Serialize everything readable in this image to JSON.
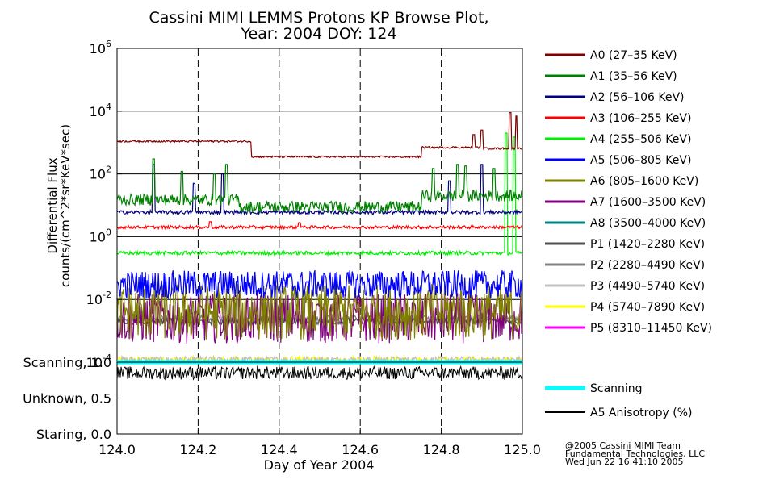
{
  "chart_data": {
    "type": "line",
    "title": "Cassini MIMI LEMMS Protons KP Browse Plot,",
    "subtitle": "Year: 2004 DOY: 124",
    "xlabel": "Day of Year 2004",
    "ylabel_line1": "Differential Flux",
    "ylabel_line2": "counts/(cm^2*sr*KeV*sec)",
    "x_ticks": [
      "124.0",
      "124.2",
      "124.4",
      "124.6",
      "124.8",
      "125.0"
    ],
    "xlim": [
      124.0,
      125.0
    ],
    "y_scale": "log",
    "ylim": [
      0.0001,
      1000000
    ],
    "y_ticks": [
      {
        "base": "10",
        "exp": "6",
        "value": 1000000
      },
      {
        "base": "10",
        "exp": "4",
        "value": 10000
      },
      {
        "base": "10",
        "exp": "2",
        "value": 100
      },
      {
        "base": "10",
        "exp": "0",
        "value": 1
      },
      {
        "base": "10",
        "exp": "-2",
        "value": 0.01
      },
      {
        "base": "10",
        "exp": "-4",
        "value": 0.0001
      }
    ],
    "grid": true,
    "legend_position": "right",
    "series": [
      {
        "name": "A0 (27–35 KeV)",
        "color": "#800000",
        "segments": [
          [
            124.0,
            124.33,
            1100
          ],
          [
            124.33,
            124.75,
            350
          ],
          [
            124.75,
            124.9,
            700
          ],
          [
            124.9,
            125.0,
            650
          ]
        ],
        "spikes": [
          [
            124.88,
            1800
          ],
          [
            124.9,
            2500
          ],
          [
            124.97,
            9000
          ],
          [
            124.985,
            7000
          ]
        ]
      },
      {
        "name": "A1 (35–56 KeV)",
        "color": "#008000",
        "segments": [
          [
            124.0,
            124.3,
            15
          ],
          [
            124.3,
            124.75,
            9
          ],
          [
            124.75,
            125.0,
            20
          ]
        ],
        "spikes": [
          [
            124.09,
            300
          ],
          [
            124.16,
            120
          ],
          [
            124.24,
            100
          ],
          [
            124.27,
            200
          ],
          [
            124.78,
            150
          ],
          [
            124.84,
            200
          ],
          [
            124.86,
            180
          ],
          [
            124.93,
            150
          ]
        ]
      },
      {
        "name": "A2 (56–106 KeV)",
        "color": "#000080",
        "segments": [
          [
            124.0,
            125.0,
            6
          ]
        ],
        "spikes": [
          [
            124.09,
            200
          ],
          [
            124.19,
            50
          ],
          [
            124.26,
            100
          ],
          [
            124.82,
            60
          ],
          [
            124.9,
            200
          ]
        ]
      },
      {
        "name": "A3 (106–255 KeV)",
        "color": "#ff0000",
        "segments": [
          [
            124.0,
            125.0,
            2
          ]
        ],
        "spikes": [
          [
            124.23,
            3
          ],
          [
            124.45,
            2.8
          ]
        ]
      },
      {
        "name": "A4 (255–506 KeV)",
        "color": "#00ee00",
        "segments": [
          [
            124.0,
            125.0,
            0.3
          ]
        ],
        "spikes": [
          [
            124.96,
            2000
          ],
          [
            124.98,
            1500
          ]
        ]
      },
      {
        "name": "A5 (506–805 KeV)",
        "color": "#0000ff",
        "segments": [
          [
            124.0,
            125.0,
            0.03
          ]
        ],
        "spikes": []
      },
      {
        "name": "A6 (805–1600 KeV)",
        "color": "#808000",
        "segments": [
          [
            124.0,
            125.0,
            0.004
          ]
        ],
        "spikes": []
      },
      {
        "name": "A7 (1600–3500 KeV)",
        "color": "#800080",
        "segments": [
          [
            124.0,
            125.0,
            0.0025
          ]
        ],
        "spikes": []
      },
      {
        "name": "A8 (3500–4000 KeV)",
        "color": "#008080",
        "segments": [],
        "spikes": []
      },
      {
        "name": "P1 (1420–2280 KeV)",
        "color": "#505050",
        "segments": [
          [
            124.0,
            125.0,
            0.002
          ]
        ],
        "spikes": []
      },
      {
        "name": "P2 (2280–4490 KeV)",
        "color": "#808080",
        "segments": [
          [
            124.0,
            125.0,
            0.0025
          ]
        ],
        "spikes": []
      },
      {
        "name": "P3 (4490–5740 KeV)",
        "color": "#c0c0c0",
        "segments": [
          [
            124.0,
            125.0,
            0.00012
          ]
        ],
        "spikes": []
      },
      {
        "name": "P4 (5740–7890 KeV)",
        "color": "#ffff00",
        "segments": [
          [
            124.0,
            125.0,
            0.00011
          ]
        ],
        "spikes": []
      },
      {
        "name": "P5 (8310–11450 KeV)",
        "color": "#ff00ff",
        "segments": [],
        "spikes": []
      }
    ],
    "lower_panel": {
      "y_ticks": [
        {
          "label": "Scanning, 1.0",
          "value": 1.0
        },
        {
          "label": "Unknown, 0.5",
          "value": 0.5
        },
        {
          "label": "Staring, 0.0",
          "value": 0.0
        }
      ],
      "ylim": [
        0.0,
        1.0
      ],
      "series": [
        {
          "name": "Scanning",
          "color": "#00ffff",
          "value": 1.0
        },
        {
          "name": "A5 Anisotropy (%)",
          "color": "#000000",
          "value": 0.85
        }
      ]
    }
  },
  "footer": {
    "line1": "@2005 Cassini MIMI Team",
    "line2": "Fundamental Technologies, LLC",
    "line3": "Wed Jun 22 16:41:10 2005"
  }
}
